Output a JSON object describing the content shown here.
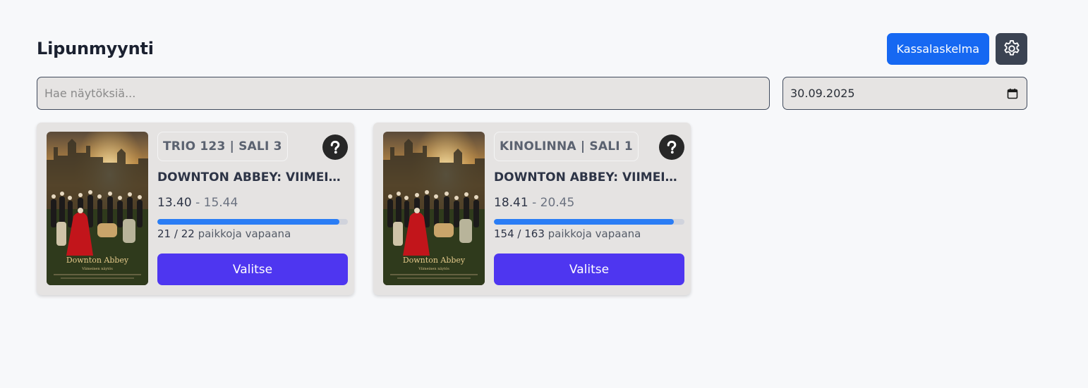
{
  "header": {
    "title": "Lipunmyynti",
    "kassalaskelma_label": "Kassalaskelma",
    "settings_icon": "gear-icon"
  },
  "search": {
    "placeholder": "Hae näytöksiä...",
    "value": ""
  },
  "date": {
    "value": "30.09.2025",
    "icon": "calendar-icon"
  },
  "shows": [
    {
      "theater": "TRIO 123 | SALI 3",
      "title": "DOWNTON ABBEY: VIIMEINEN NÄYTÖS",
      "price_min": "13.40",
      "price_sep": "-",
      "price_max": "15.44",
      "seats_free": "21",
      "seats_total": "22",
      "seats_label": "paikkoja vapaana",
      "occupancy_fraction": 0.955,
      "select_label": "Valitse",
      "poster_title": "Downton Abbey",
      "poster_subtitle": "Viimeinen näytös"
    },
    {
      "theater": "KINOLINNA | SALI 1",
      "title": "DOWNTON ABBEY: VIIMEINEN NÄYTÖS",
      "price_min": "18.41",
      "price_sep": "-",
      "price_max": "20.45",
      "seats_free": "154",
      "seats_total": "163",
      "seats_label": "paikkoja vapaana",
      "occupancy_fraction": 0.945,
      "select_label": "Valitse",
      "poster_title": "Downton Abbey",
      "poster_subtitle": "Viimeinen näytös"
    }
  ],
  "colors": {
    "primary": "#1668f2",
    "select": "#4e36f0",
    "progress": "#2a7df5"
  }
}
